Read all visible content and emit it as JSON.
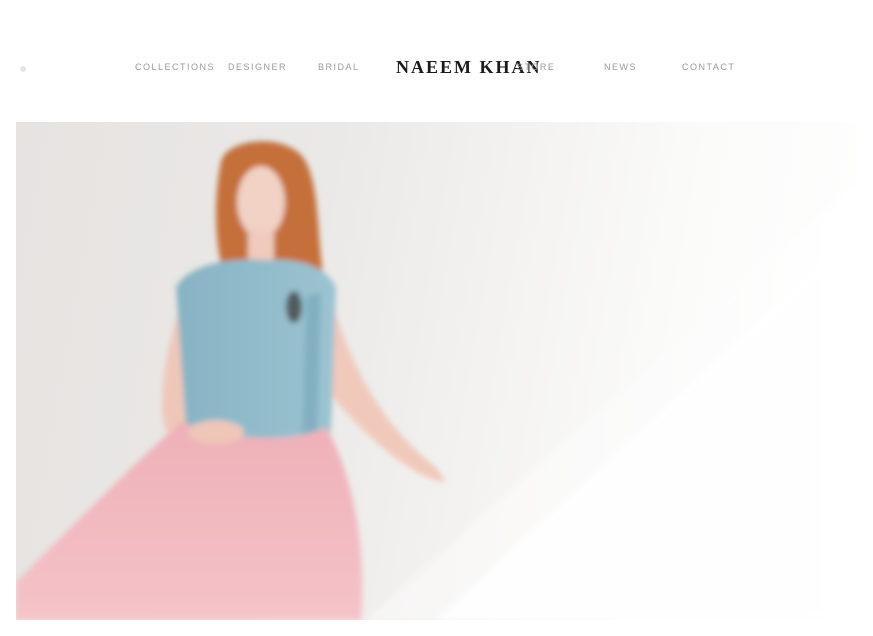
{
  "nav": {
    "items_left": [
      "COLLECTIONS",
      "DESIGNER",
      "BRIDAL"
    ],
    "brand": "NAEEM KHAN",
    "items_right": [
      "STORE",
      "NEWS",
      "CONTACT"
    ]
  },
  "hero": {
    "caption": ""
  },
  "colors": {
    "background": "#ffffff",
    "brand_text": "#1a1a1a",
    "nav_text": "#9a9a9a",
    "top": "#8fb8c8",
    "skirt": "#f0b3ba",
    "hair": "#c8733f"
  }
}
